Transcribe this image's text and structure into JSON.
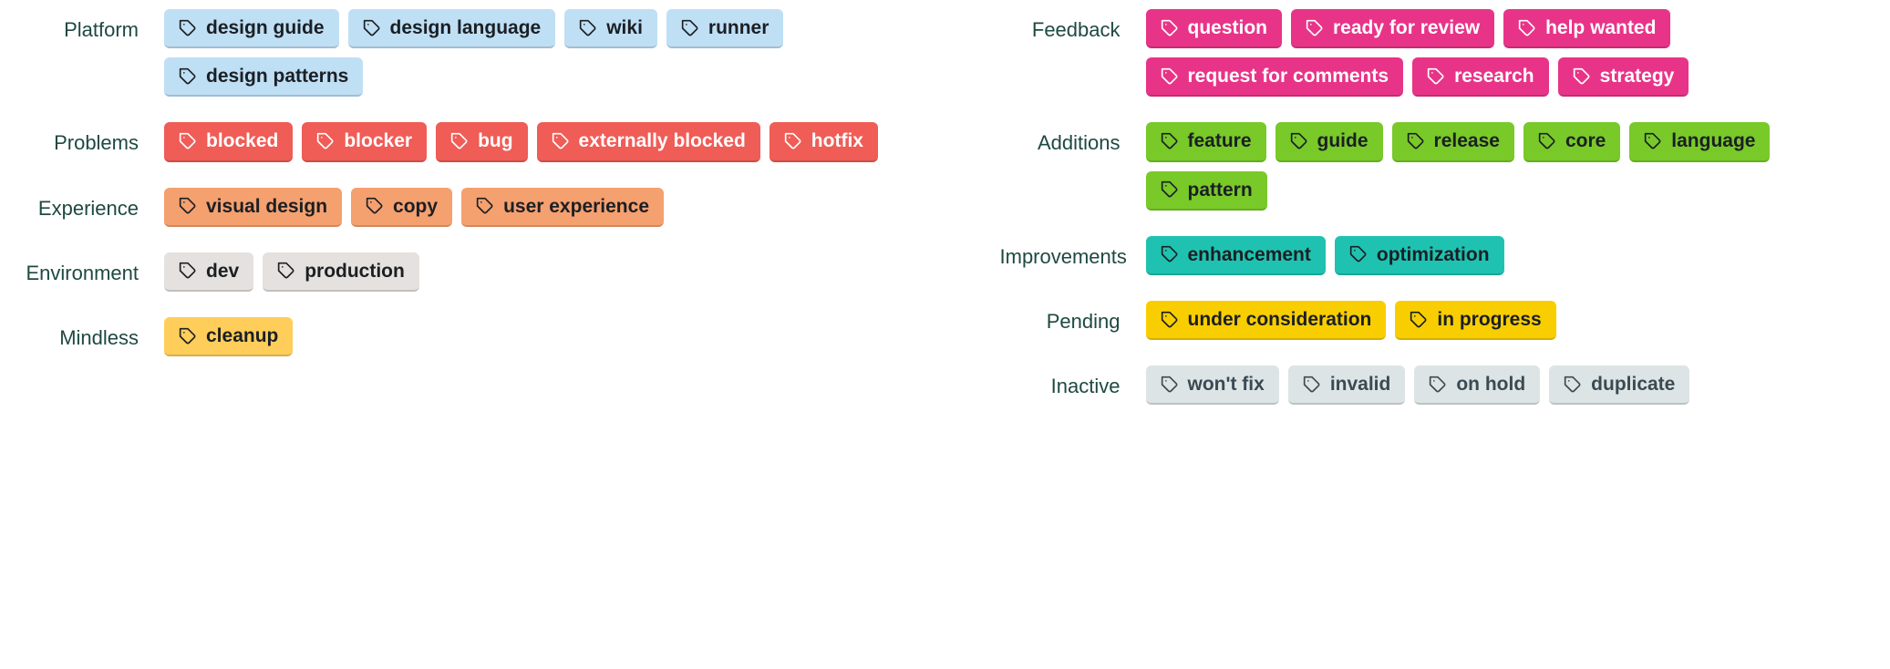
{
  "leftColumn": [
    {
      "name": "platform",
      "label": "Platform",
      "colorClass": "c-lightblue",
      "tags": [
        "design guide",
        "design language",
        "wiki",
        "runner",
        "design patterns"
      ]
    },
    {
      "name": "problems",
      "label": "Problems",
      "colorClass": "c-red",
      "tags": [
        "blocked",
        "blocker",
        "bug",
        "externally blocked",
        "hotfix"
      ]
    },
    {
      "name": "experience",
      "label": "Experience",
      "colorClass": "c-orange",
      "tags": [
        "visual design",
        "copy",
        "user experience"
      ]
    },
    {
      "name": "environment",
      "label": "Environment",
      "colorClass": "c-greylight",
      "tags": [
        "dev",
        "production"
      ]
    },
    {
      "name": "mindless",
      "label": "Mindless",
      "colorClass": "c-amber",
      "tags": [
        "cleanup"
      ]
    }
  ],
  "rightColumn": [
    {
      "name": "feedback",
      "label": "Feedback",
      "colorClass": "c-pink",
      "tags": [
        "question",
        "ready for review",
        "help wanted",
        "request for comments",
        "research",
        "strategy"
      ]
    },
    {
      "name": "additions",
      "label": "Additions",
      "colorClass": "c-green",
      "tags": [
        "feature",
        "guide",
        "release",
        "core",
        "language",
        "pattern"
      ]
    },
    {
      "name": "improvements",
      "label": "Improvements",
      "colorClass": "c-teal",
      "tags": [
        "enhancement",
        "optimization"
      ]
    },
    {
      "name": "pending",
      "label": "Pending",
      "colorClass": "c-yellow",
      "tags": [
        "under consideration",
        "in progress"
      ]
    },
    {
      "name": "inactive",
      "label": "Inactive",
      "colorClass": "c-bluegrey",
      "tags": [
        "won't fix",
        "invalid",
        "on hold",
        "duplicate"
      ]
    }
  ]
}
